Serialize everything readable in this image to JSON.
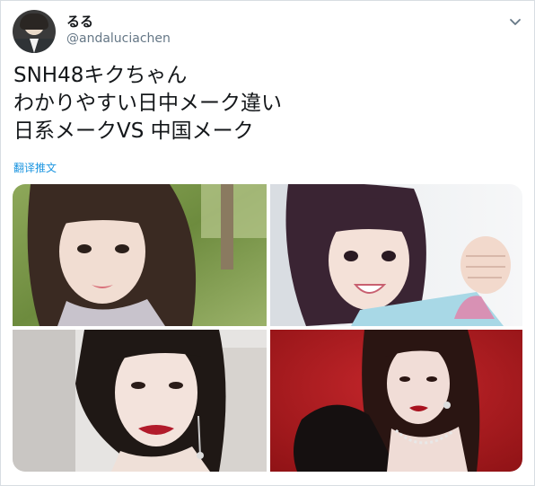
{
  "tweet": {
    "display_name": "るる",
    "handle": "@andaluciachen",
    "text_lines": [
      "SNH48キクちゃん",
      "わかりやすい日中メーク違い",
      "日系メークVS 中国メーク"
    ],
    "translate_label": "翻译推文"
  },
  "icons": {
    "caret": "chevron-down-icon"
  },
  "colors": {
    "text": "#14171a",
    "secondary": "#657786",
    "link": "#1b95e0"
  },
  "photos": [
    {
      "name": "photo-1",
      "description": "selfie with bangs outdoors"
    },
    {
      "name": "photo-2",
      "description": "smiling girl with fist raised"
    },
    {
      "name": "photo-3",
      "description": "portrait with red lips and earrings"
    },
    {
      "name": "photo-4",
      "description": "portrait on red background"
    }
  ]
}
